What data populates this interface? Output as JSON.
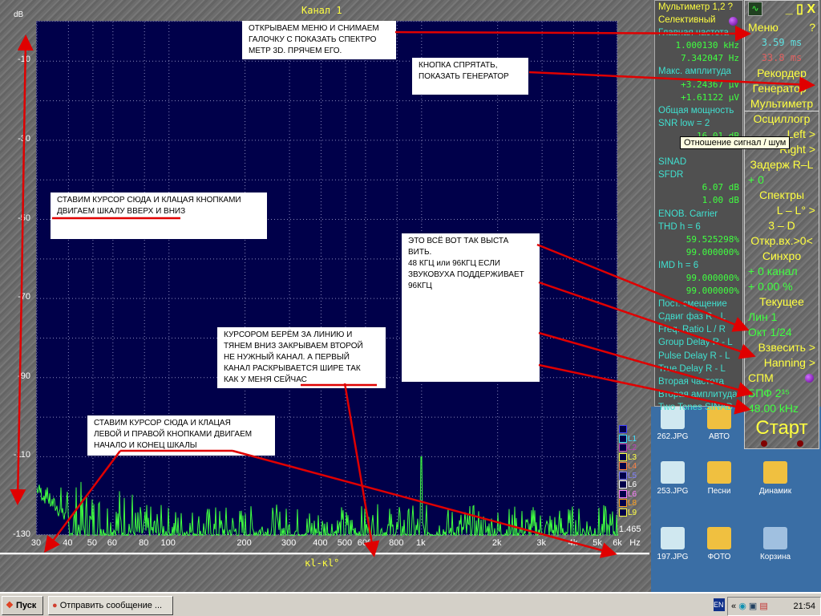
{
  "plot": {
    "title": "Канал 1",
    "y_unit": "dB",
    "x_unit": "Hz",
    "x_title": "кl-кl°",
    "y_ticks": [
      "-10",
      "-30",
      "-50",
      "-70",
      "-90",
      "-110",
      "-130"
    ],
    "x_ticks": [
      "30",
      "40",
      "50",
      "60",
      "80",
      "100",
      "200",
      "300",
      "400",
      "500",
      "600",
      "800",
      "1k",
      "2k",
      "3k",
      "4k",
      "5k",
      "6k"
    ],
    "y_range_db": [
      -130,
      0
    ],
    "x_range_hz": [
      30,
      6000
    ],
    "x_scale": "log",
    "peak": {
      "freq_hz": 1000,
      "level_db": -110
    },
    "trace_color": "#40ff40",
    "background_color": "#00004a",
    "scale_value": "1.465",
    "legend": [
      {
        "label": "",
        "color": "#4040ff"
      },
      {
        "label": "L1",
        "color": "#40e0ff"
      },
      {
        "label": "L2",
        "color": "#c040c0"
      },
      {
        "label": "L3",
        "color": "#ffff40"
      },
      {
        "label": "L4",
        "color": "#ff8040"
      },
      {
        "label": "L5",
        "color": "#8080ff"
      },
      {
        "label": "L6",
        "color": "#ffffff"
      },
      {
        "label": "L6",
        "color": "#ff80ff"
      },
      {
        "label": "L8",
        "color": "#ffa020"
      },
      {
        "label": "L9",
        "color": "#ffff40"
      }
    ]
  },
  "notes": [
    "ОТКРЫВАЕМ  МЕНЮ И  СНИМАЕМ\nГАЛОЧКУ С ПОКАЗАТЬ СПЕКТРО\nМЕТР 3D. ПРЯЧЕМ ЕГО.",
    "КНОПКА СПРЯТАТЬ,\nПОКАЗАТЬ ГЕНЕРАТОР",
    "СТАВИМ КУРСОР СЮДА  И  КЛАЦАЯ КНОПКАМИ\nДВИГАЕМ ШКАЛУ ВВЕРХ И ВНИЗ",
    "ЭТО ВСЁ ВОТ ТАК ВЫСТА\nВИТЬ.\n48 КГЦ или 96КГЦ  ЕСЛИ\nЗВУКОВУХА ПОДДЕРЖИВАЕТ\n96КГЦ",
    "КУРСОРОМ  БЕРЁМ  ЗА  ЛИНИЮ  И\nТЯНЕМ  ВНИЗ  ЗАКРЫВАЕМ  ВТОРОЙ\nНЕ  НУЖНЫЙ   КАНАЛ. А  ПЕРВЫЙ\nКАНАЛ  РАСКРЫВАЕТСЯ  ШИРЕ  ТАК\nКАК  У  МЕНЯ  СЕЙЧАС",
    "СТАВИМ КУРСОР СЮДА И КЛАЦАЯ\nЛЕВОЙ  И  ПРАВОЙ  КНОПКАМИ  ДВИГАЕМ\nНАЧАЛО  И  КОНЕЦ  ШКАЛЫ"
  ],
  "multimeter": {
    "rows": [
      {
        "t": "Мультиметр 1,2 ?",
        "c": "ye"
      },
      {
        "t": "Селективный",
        "c": "ye",
        "dot": true
      },
      {
        "t": "Главная частота",
        "c": "cy"
      },
      {
        "t": "1.000130 kHz",
        "c": "gr"
      },
      {
        "t": "7.342047  Hz",
        "c": "gr"
      },
      {
        "t": "Макс. амплитуда",
        "c": "cy"
      },
      {
        "t": "+3.24367 µV",
        "c": "gr"
      },
      {
        "t": "+1.61122 µV",
        "c": "gr"
      },
      {
        "t": "Общая мощность",
        "c": "cy"
      },
      {
        "t": "SNR     low =   2",
        "c": "cy"
      },
      {
        "t": "16.01 dB",
        "c": "gr"
      },
      {
        "t": "",
        "c": "gr"
      },
      {
        "t": "SINAD",
        "c": "cy"
      },
      {
        "t": "SFDR",
        "c": "cy"
      },
      {
        "t": "6.07 dB",
        "c": "gr"
      },
      {
        "t": "1.00 dB",
        "c": "gr"
      },
      {
        "t": "ENOB. Carrier",
        "c": "cy"
      },
      {
        "t": "THD      h =     6",
        "c": "cy"
      },
      {
        "t": "59.525298%",
        "c": "gr"
      },
      {
        "t": "99.000000%",
        "c": "gr"
      },
      {
        "t": "IMD      h =     6",
        "c": "cy"
      },
      {
        "t": "99.000000%",
        "c": "gr"
      },
      {
        "t": "99.000000%",
        "c": "gr"
      },
      {
        "t": "Пост. смещение",
        "c": "cy"
      },
      {
        "t": "Сдвиг фаз R - L",
        "c": "cy"
      },
      {
        "t": "Freq. Ratio L / R",
        "c": "cy"
      },
      {
        "t": "Group Delay R - L",
        "c": "cy"
      },
      {
        "t": "Pulse Delay R - L",
        "c": "cy"
      },
      {
        "t": "True  Delay R - L",
        "c": "cy"
      },
      {
        "t": "Вторая частота",
        "c": "cy"
      },
      {
        "t": "Вторая амплитуда",
        "c": "cy"
      },
      {
        "t": "Two Tones SINAD",
        "c": "cy"
      }
    ],
    "tooltip": "Отношение сигнал / шум"
  },
  "control": {
    "window_buttons": "_ ▯ X",
    "menu": "Меню",
    "help": "?",
    "time1": "3.59 ms",
    "time2": "33.8 ms",
    "rows": [
      {
        "t": "Рекордер",
        "c": "c"
      },
      {
        "t": "Генератор°",
        "c": "c"
      },
      {
        "t": "Мультиметр",
        "c": "c"
      },
      {
        "t": "Осциллогр",
        "c": "c"
      },
      {
        "t": "Left  >",
        "c": "r"
      },
      {
        "t": "Right  >",
        "c": "r"
      },
      {
        "t": "Задерж R–L",
        "c": "c"
      },
      {
        "t": "+          0",
        "c": "g"
      },
      {
        "t": "Спектры",
        "c": "c"
      },
      {
        "t": "L – L°  >",
        "c": "r"
      },
      {
        "t": "3 – D",
        "c": "c"
      },
      {
        "t": "Откр.вх.>0<",
        "c": "c"
      },
      {
        "t": "Синхро",
        "c": "c"
      },
      {
        "t": "+  0 канал",
        "c": "g"
      },
      {
        "t": "+  0.00 %",
        "c": "g"
      },
      {
        "t": "Текущее",
        "c": "c"
      },
      {
        "t": "Лин        1",
        "c": "g"
      },
      {
        "t": "Окт  1/24",
        "c": "g"
      },
      {
        "t": "Взвесить >",
        "c": "r"
      },
      {
        "t": "Hanning >",
        "c": "r"
      },
      {
        "t": "СПМ",
        "c": "dot"
      },
      {
        "t": "БПФ 2¹⁵",
        "c": "g"
      },
      {
        "t": "48.00 kHz",
        "c": "g"
      }
    ],
    "start": "Старт"
  },
  "desktop": {
    "icons": [
      "262.JPG",
      "АВТО",
      "253.JPG",
      "Песни",
      "Динамик",
      "197.JPG",
      "ФОТО",
      "Корзина"
    ]
  },
  "taskbar": {
    "start": "Пуск",
    "task": "Отправить сообщение ...",
    "lang": "EN",
    "clock": "21:54"
  }
}
